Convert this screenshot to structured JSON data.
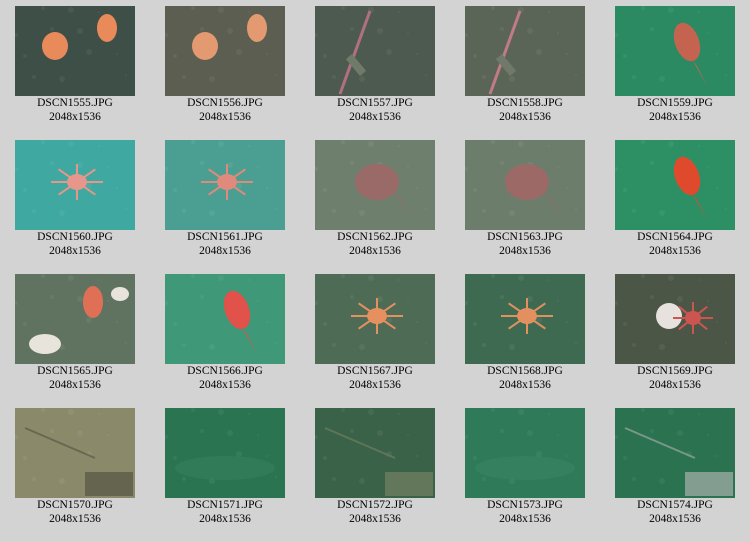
{
  "gallery": {
    "items": [
      {
        "filename": "DSCN1555.JPG",
        "dimensions": "2048x1536",
        "bg": "#3e4f48",
        "fg": "#e98a5a",
        "subject": "sea-anemone"
      },
      {
        "filename": "DSCN1556.JPG",
        "dimensions": "2048x1536",
        "bg": "#5c5e52",
        "fg": "#e39a70",
        "subject": "sea-anemone"
      },
      {
        "filename": "DSCN1557.JPG",
        "dimensions": "2048x1536",
        "bg": "#4d5a4f",
        "fg": "#b07080",
        "subject": "cable"
      },
      {
        "filename": "DSCN1558.JPG",
        "dimensions": "2048x1536",
        "bg": "#5a6558",
        "fg": "#c07a88",
        "subject": "cable"
      },
      {
        "filename": "DSCN1559.JPG",
        "dimensions": "2048x1536",
        "bg": "#2b8a62",
        "fg": "#c46450",
        "subject": "fish"
      },
      {
        "filename": "DSCN1560.JPG",
        "dimensions": "2048x1536",
        "bg": "#3fa8a0",
        "fg": "#e6968a",
        "subject": "crab"
      },
      {
        "filename": "DSCN1561.JPG",
        "dimensions": "2048x1536",
        "bg": "#4b9f92",
        "fg": "#df8a7c",
        "subject": "crab"
      },
      {
        "filename": "DSCN1562.JPG",
        "dimensions": "2048x1536",
        "bg": "#6f7f6e",
        "fg": "#9a6a68",
        "subject": "flatfish"
      },
      {
        "filename": "DSCN1563.JPG",
        "dimensions": "2048x1536",
        "bg": "#6d7d6c",
        "fg": "#9c6966",
        "subject": "flatfish"
      },
      {
        "filename": "DSCN1564.JPG",
        "dimensions": "2048x1536",
        "bg": "#2c9064",
        "fg": "#e04a2c",
        "subject": "fish"
      },
      {
        "filename": "DSCN1565.JPG",
        "dimensions": "2048x1536",
        "bg": "#5f7360",
        "fg": "#e07055",
        "subject": "anemones"
      },
      {
        "filename": "DSCN1566.JPG",
        "dimensions": "2048x1536",
        "bg": "#3f9878",
        "fg": "#e0524a",
        "subject": "fish"
      },
      {
        "filename": "DSCN1567.JPG",
        "dimensions": "2048x1536",
        "bg": "#4e6b55",
        "fg": "#e69060",
        "subject": "crab"
      },
      {
        "filename": "DSCN1568.JPG",
        "dimensions": "2048x1536",
        "bg": "#3f6a52",
        "fg": "#e29060",
        "subject": "crab"
      },
      {
        "filename": "DSCN1569.JPG",
        "dimensions": "2048x1536",
        "bg": "#4c5646",
        "fg": "#cc5550",
        "subject": "crab-ball"
      },
      {
        "filename": "DSCN1570.JPG",
        "dimensions": "2048x1536",
        "bg": "#8a8a6a",
        "fg": "#5a5a48",
        "subject": "debris"
      },
      {
        "filename": "DSCN1571.JPG",
        "dimensions": "2048x1536",
        "bg": "#2a7452",
        "fg": "#3d8664",
        "subject": "seafloor"
      },
      {
        "filename": "DSCN1572.JPG",
        "dimensions": "2048x1536",
        "bg": "#3a6248",
        "fg": "#6e7e60",
        "subject": "debris"
      },
      {
        "filename": "DSCN1573.JPG",
        "dimensions": "2048x1536",
        "bg": "#2f7a58",
        "fg": "#3e8a68",
        "subject": "seafloor"
      },
      {
        "filename": "DSCN1574.JPG",
        "dimensions": "2048x1536",
        "bg": "#2b7250",
        "fg": "#9aa8a0",
        "subject": "debris"
      }
    ]
  }
}
